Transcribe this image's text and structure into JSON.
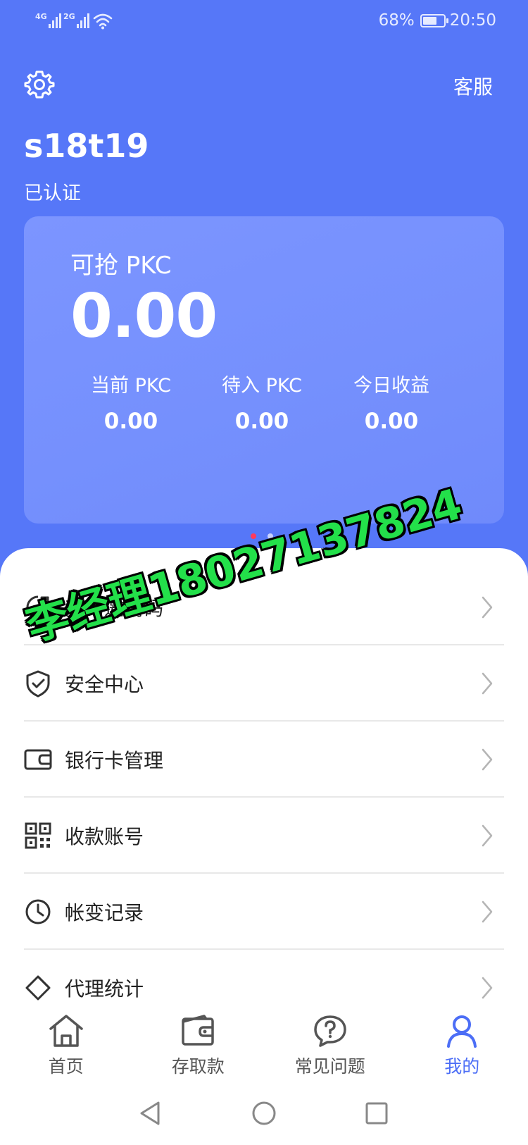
{
  "status_bar": {
    "sim1": "4G",
    "sim2": "2G",
    "battery_percent": "68%",
    "battery_level": 0.68,
    "time": "20:50"
  },
  "header": {
    "settings_icon": "gear-icon",
    "customer_service": "客服",
    "username": "s18t19",
    "verification_status": "已认证"
  },
  "card": {
    "label": "可抢 PKC",
    "value": "0.00",
    "stats": [
      {
        "label": "当前 PKC",
        "value": "0.00"
      },
      {
        "label": "待入 PKC",
        "value": "0.00"
      },
      {
        "label": "今日收益",
        "value": "0.00"
      }
    ],
    "carousel": {
      "count": 2,
      "active_index": 0
    }
  },
  "menu": {
    "items": [
      {
        "label": "我的邀请码",
        "icon": "share-icon"
      },
      {
        "label": "安全中心",
        "icon": "shield-icon"
      },
      {
        "label": "银行卡管理",
        "icon": "wallet-icon"
      },
      {
        "label": "收款账号",
        "icon": "qr-code-icon"
      },
      {
        "label": "帐变记录",
        "icon": "clock-icon"
      },
      {
        "label": "代理统计",
        "icon": "tag-icon"
      }
    ]
  },
  "watermark": "李经理18027137824",
  "tabbar": {
    "items": [
      {
        "label": "首页",
        "icon": "home-icon"
      },
      {
        "label": "存取款",
        "icon": "wallet-icon"
      },
      {
        "label": "常见问题",
        "icon": "question-icon"
      },
      {
        "label": "我的",
        "icon": "user-icon"
      }
    ],
    "active_index": 3
  },
  "colors": {
    "primary": "#5677f8",
    "card": "#7590fd",
    "active_tab": "#4c6ef6",
    "dot_active": "#ff3b5c",
    "dot_inactive": "#c9d3ff",
    "watermark": "#23e04a"
  }
}
